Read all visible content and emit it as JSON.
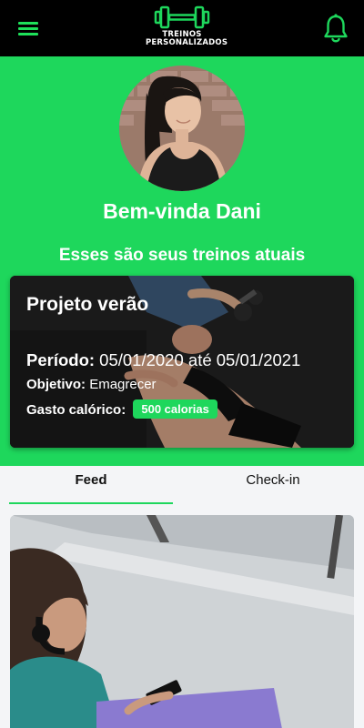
{
  "header": {
    "menu_icon": "hamburger-menu-icon",
    "logo_icon": "dumbbell-icon",
    "logo_line1": "TREINOS",
    "logo_line2": "PERSONALIZADOS",
    "notification_icon": "bell-icon",
    "accent_color": "#1ed75c"
  },
  "profile": {
    "welcome_prefix": "Bem-vinda",
    "name": "Dani",
    "subtitle": "Esses são seus treinos atuais"
  },
  "workout": {
    "title": "Projeto verão",
    "period_label": "Período:",
    "period_value": "05/01/2020 até 05/01/2021",
    "objective_label": "Objetivo:",
    "objective_value": "Emagrecer",
    "calories_label": "Gasto calórico:",
    "calories_value": "500 calorias"
  },
  "tabs": [
    {
      "label": "Feed",
      "active": true
    },
    {
      "label": "Check-in",
      "active": false
    }
  ]
}
